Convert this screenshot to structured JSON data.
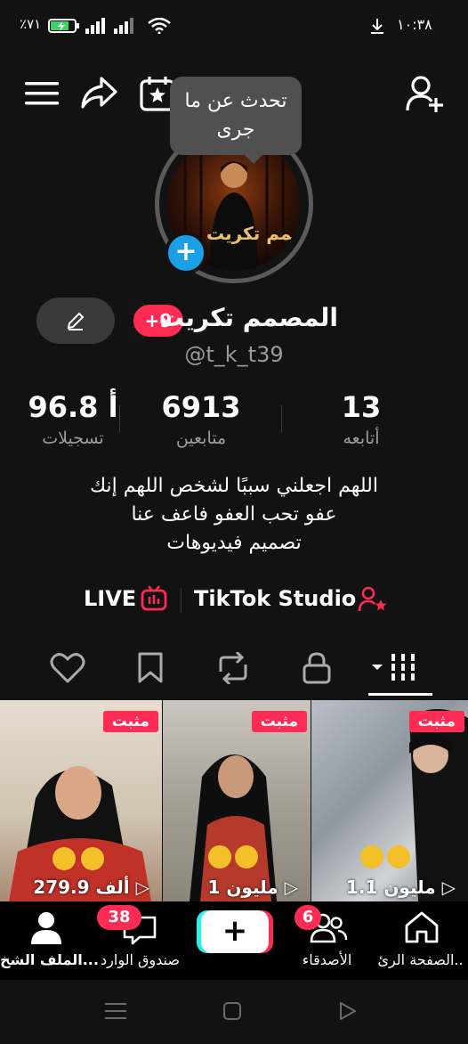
{
  "status_bar": {
    "battery": "٪٧١",
    "time": "١٠:٣٨"
  },
  "header": {
    "tooltip": "تحدث عن ما جرى",
    "icons": [
      "menu-icon",
      "share-icon",
      "calendar-star-icon",
      "add-friend-icon"
    ]
  },
  "profile": {
    "name": "المصمم تكريت",
    "handle": "@t_k_t39",
    "notification_badge": "+9",
    "avatar_text": "المصمم تكريت"
  },
  "stats": [
    {
      "value": "13",
      "label": "أتابعه"
    },
    {
      "value": "6913",
      "label": "متابعين"
    },
    {
      "value": "96.8 أ",
      "label": "تسجيلات"
    }
  ],
  "bio": {
    "line1": "اللهم اجعلني سببًا لشخص اللهم إنك",
    "line2": "عفو تحب العفو فاعف عنا",
    "line3": "تصميم فيديوهات"
  },
  "links": {
    "studio": "TikTok Studio",
    "live": "LIVE"
  },
  "tabs": [
    "videos-grid-tab",
    "private-tab",
    "reposts-tab",
    "favorites-tab",
    "liked-tab"
  ],
  "videos": [
    {
      "pin": "مثبت",
      "views": "1.1 مليون"
    },
    {
      "pin": "مثبت",
      "views": "1 مليون"
    },
    {
      "pin": "مثبت",
      "views": "279.9 ألف"
    }
  ],
  "nav": {
    "home": "الصفحة الرئ..",
    "friends": "الأصدقاء",
    "friends_badge": "6",
    "inbox": "صندوق الوارد",
    "inbox_badge": "38",
    "profile": "الملف الشخ..."
  },
  "colors": {
    "accent": "#fe2c55",
    "blue": "#1ba0e6",
    "background": "#121212"
  }
}
